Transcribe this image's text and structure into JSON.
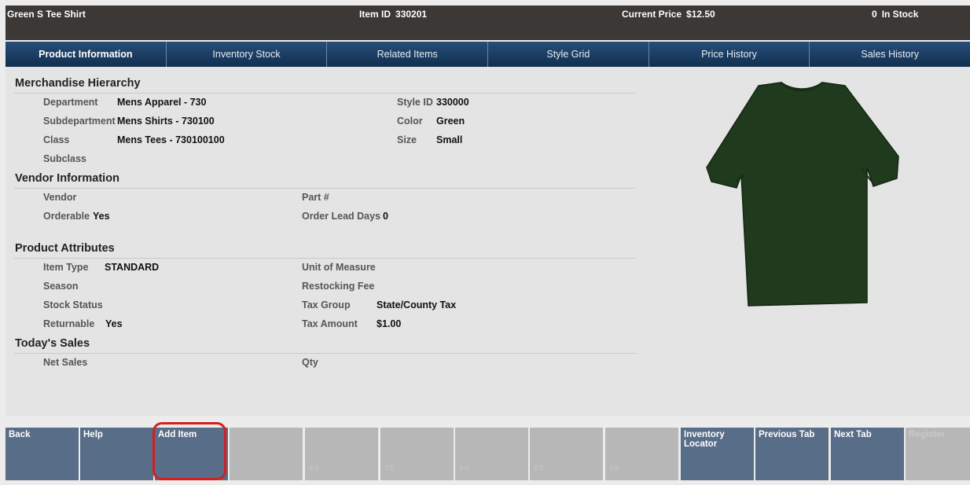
{
  "header": {
    "product_name": "Green S Tee Shirt",
    "item_id_label": "Item ID",
    "item_id": "330201",
    "price_label": "Current Price",
    "price": "$12.50",
    "stock_qty": "0",
    "stock_label": "In Stock"
  },
  "tabs": [
    {
      "label": "Product Information"
    },
    {
      "label": "Inventory Stock"
    },
    {
      "label": "Related Items"
    },
    {
      "label": "Style Grid"
    },
    {
      "label": "Price History"
    },
    {
      "label": "Sales History"
    }
  ],
  "merch": {
    "title": "Merchandise Hierarchy",
    "department_label": "Department",
    "department": "Mens Apparel - 730",
    "subdepartment_label": "Subdepartment",
    "subdepartment": "Mens Shirts - 730100",
    "class_label": "Class",
    "class": "Mens Tees - 730100100",
    "subclass_label": "Subclass",
    "style_id_label": "Style ID",
    "style_id": "330000",
    "color_label": "Color",
    "color": "Green",
    "size_label": "Size",
    "size": "Small"
  },
  "vendor": {
    "title": "Vendor Information",
    "vendor_label": "Vendor",
    "orderable_label": "Orderable",
    "orderable": "Yes",
    "part_label": "Part #",
    "lead_days_label": "Order Lead Days",
    "lead_days": "0"
  },
  "attributes": {
    "title": "Product Attributes",
    "item_type_label": "Item Type",
    "item_type": "STANDARD",
    "season_label": "Season",
    "stock_status_label": "Stock Status",
    "returnable_label": "Returnable",
    "returnable": "Yes",
    "uom_label": "Unit of Measure",
    "restocking_label": "Restocking Fee",
    "tax_group_label": "Tax Group",
    "tax_group": "State/County Tax",
    "tax_amount_label": "Tax Amount",
    "tax_amount": "$1.00"
  },
  "sales": {
    "title": "Today's Sales",
    "net_sales_label": "Net Sales",
    "qty_label": "Qty"
  },
  "image": {
    "shirt_color": "#1f3a1c",
    "icon": "tee-shirt-icon"
  },
  "fkeys": [
    {
      "label": "Back",
      "fnum": ""
    },
    {
      "label": "Help",
      "fnum": ""
    },
    {
      "label": "Add Item",
      "fnum": ""
    },
    {
      "label": "",
      "fnum": ""
    },
    {
      "label": "",
      "fnum": "F4"
    },
    {
      "label": "",
      "fnum": "F5"
    },
    {
      "label": "",
      "fnum": "F6"
    },
    {
      "label": "",
      "fnum": "F7"
    },
    {
      "label": "",
      "fnum": "F8"
    },
    {
      "label": "Inventory Locator",
      "fnum": ""
    },
    {
      "label": "Previous Tab",
      "fnum": ""
    },
    {
      "label": "Next Tab",
      "fnum": ""
    },
    {
      "label": "Register",
      "fnum": ""
    }
  ],
  "colors": {
    "header_bg": "#3b3835",
    "tab_bg": "#1b3d63",
    "fkey_bg": "#586d87",
    "highlight": "#d41f1f"
  }
}
